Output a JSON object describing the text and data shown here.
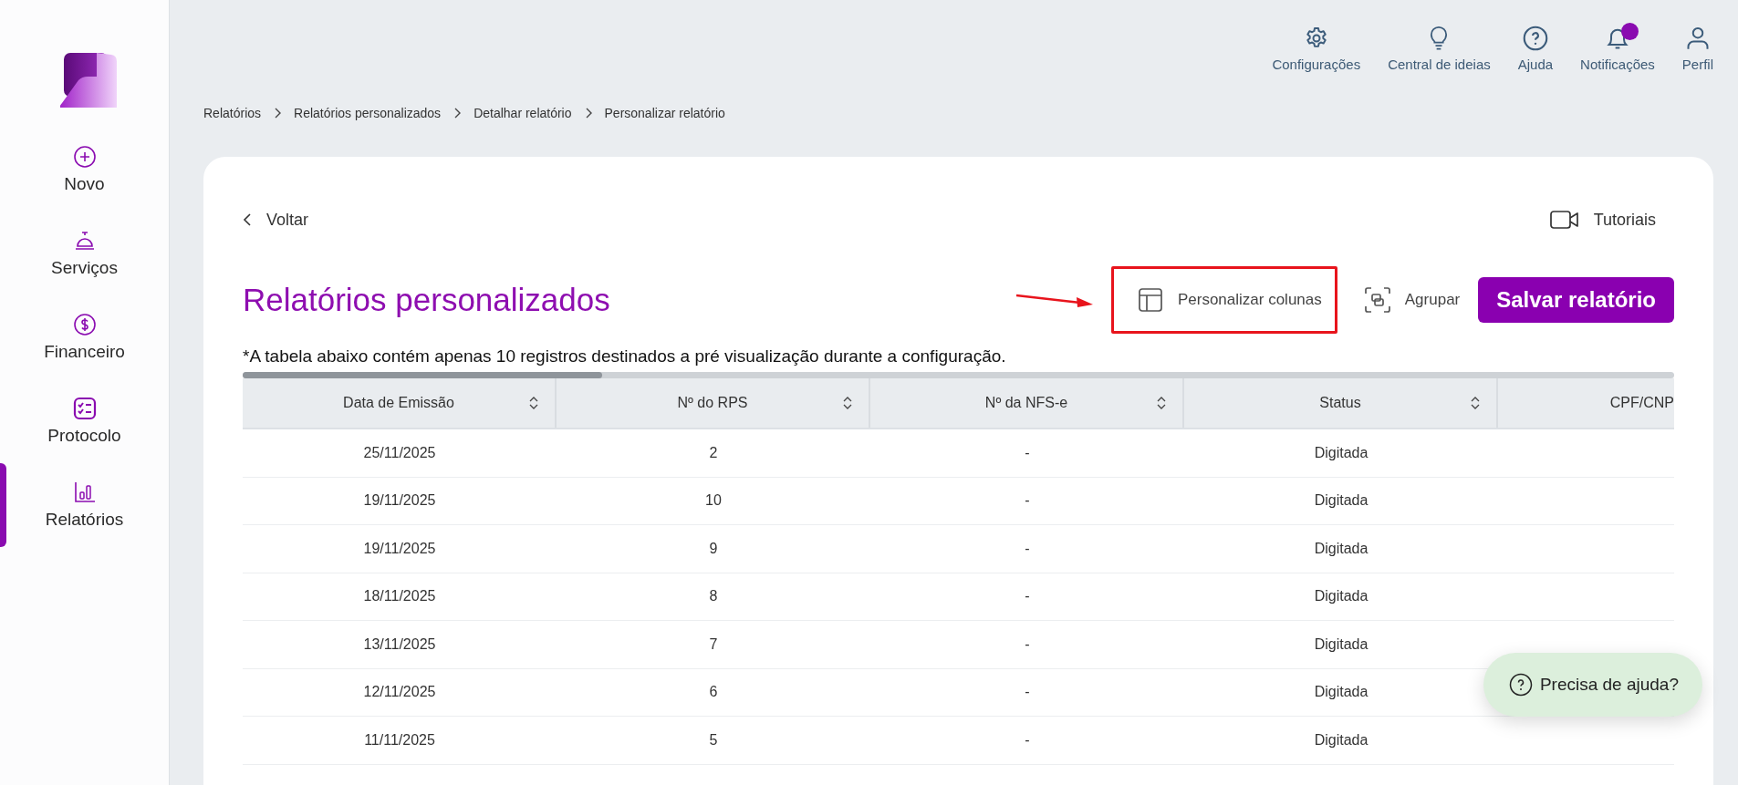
{
  "sidebar": {
    "items": [
      {
        "label": "Novo",
        "selected": false
      },
      {
        "label": "Serviços",
        "selected": false
      },
      {
        "label": "Financeiro",
        "selected": false
      },
      {
        "label": "Protocolo",
        "selected": false
      },
      {
        "label": "Relatórios",
        "selected": true
      }
    ]
  },
  "header": {
    "items": [
      {
        "label": "Configurações",
        "badge": false
      },
      {
        "label": "Central de ideias",
        "badge": false
      },
      {
        "label": "Ajuda",
        "badge": false
      },
      {
        "label": "Notificações",
        "badge": true
      },
      {
        "label": "Perfil",
        "badge": false
      }
    ]
  },
  "breadcrumb": [
    "Relatórios",
    "Relatórios personalizados",
    "Detalhar relatório",
    "Personalizar relatório"
  ],
  "back": "Voltar",
  "tutorials": "Tutoriais",
  "title": "Relatórios personalizados",
  "actions": {
    "customize": "Personalizar colunas",
    "customize_highlighted": true,
    "group": "Agrupar",
    "save": "Salvar relatório"
  },
  "note": "*A tabela abaixo contém apenas 10 registros destinados a pré visualização durante a configuração.",
  "table": {
    "columns": [
      {
        "label": "Data de Emissão",
        "sortable": true
      },
      {
        "label": "Nº do RPS",
        "sortable": true
      },
      {
        "label": "Nº da NFS-e",
        "sortable": true
      },
      {
        "label": "Status",
        "sortable": true
      },
      {
        "label": "CPF/CNP",
        "sortable": false
      }
    ],
    "rows": [
      [
        "25/11/2025",
        "2",
        "-",
        "Digitada"
      ],
      [
        "19/11/2025",
        "10",
        "-",
        "Digitada"
      ],
      [
        "19/11/2025",
        "9",
        "-",
        "Digitada"
      ],
      [
        "18/11/2025",
        "8",
        "-",
        "Digitada"
      ],
      [
        "13/11/2025",
        "7",
        "-",
        "Digitada"
      ],
      [
        "12/11/2025",
        "6",
        "-",
        "Digitada"
      ],
      [
        "11/11/2025",
        "5",
        "-",
        "Digitada"
      ]
    ]
  },
  "help_button": "Precisa de ajuda?"
}
